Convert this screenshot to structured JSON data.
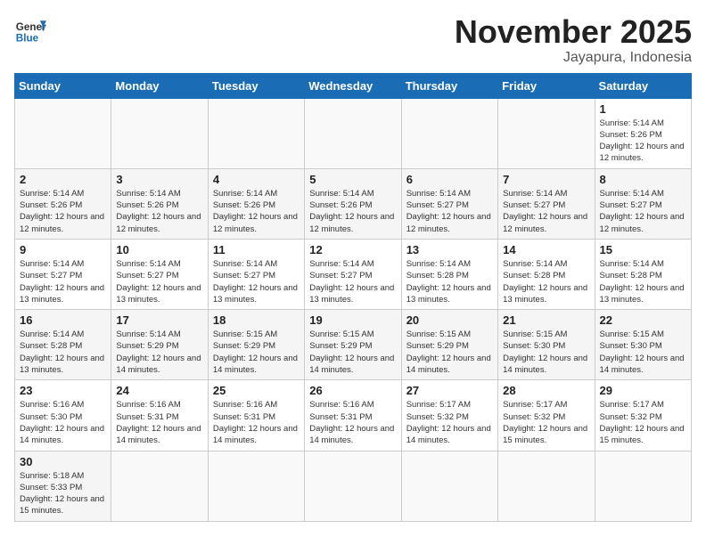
{
  "header": {
    "logo_general": "General",
    "logo_blue": "Blue",
    "month_title": "November 2025",
    "location": "Jayapura, Indonesia"
  },
  "weekdays": [
    "Sunday",
    "Monday",
    "Tuesday",
    "Wednesday",
    "Thursday",
    "Friday",
    "Saturday"
  ],
  "weeks": [
    [
      {
        "day": "",
        "sunrise": "",
        "sunset": "",
        "daylight": ""
      },
      {
        "day": "",
        "sunrise": "",
        "sunset": "",
        "daylight": ""
      },
      {
        "day": "",
        "sunrise": "",
        "sunset": "",
        "daylight": ""
      },
      {
        "day": "",
        "sunrise": "",
        "sunset": "",
        "daylight": ""
      },
      {
        "day": "",
        "sunrise": "",
        "sunset": "",
        "daylight": ""
      },
      {
        "day": "",
        "sunrise": "",
        "sunset": "",
        "daylight": ""
      },
      {
        "day": "1",
        "sunrise": "Sunrise: 5:14 AM",
        "sunset": "Sunset: 5:26 PM",
        "daylight": "Daylight: 12 hours and 12 minutes."
      }
    ],
    [
      {
        "day": "2",
        "sunrise": "Sunrise: 5:14 AM",
        "sunset": "Sunset: 5:26 PM",
        "daylight": "Daylight: 12 hours and 12 minutes."
      },
      {
        "day": "3",
        "sunrise": "Sunrise: 5:14 AM",
        "sunset": "Sunset: 5:26 PM",
        "daylight": "Daylight: 12 hours and 12 minutes."
      },
      {
        "day": "4",
        "sunrise": "Sunrise: 5:14 AM",
        "sunset": "Sunset: 5:26 PM",
        "daylight": "Daylight: 12 hours and 12 minutes."
      },
      {
        "day": "5",
        "sunrise": "Sunrise: 5:14 AM",
        "sunset": "Sunset: 5:26 PM",
        "daylight": "Daylight: 12 hours and 12 minutes."
      },
      {
        "day": "6",
        "sunrise": "Sunrise: 5:14 AM",
        "sunset": "Sunset: 5:27 PM",
        "daylight": "Daylight: 12 hours and 12 minutes."
      },
      {
        "day": "7",
        "sunrise": "Sunrise: 5:14 AM",
        "sunset": "Sunset: 5:27 PM",
        "daylight": "Daylight: 12 hours and 12 minutes."
      },
      {
        "day": "8",
        "sunrise": "Sunrise: 5:14 AM",
        "sunset": "Sunset: 5:27 PM",
        "daylight": "Daylight: 12 hours and 12 minutes."
      }
    ],
    [
      {
        "day": "9",
        "sunrise": "Sunrise: 5:14 AM",
        "sunset": "Sunset: 5:27 PM",
        "daylight": "Daylight: 12 hours and 13 minutes."
      },
      {
        "day": "10",
        "sunrise": "Sunrise: 5:14 AM",
        "sunset": "Sunset: 5:27 PM",
        "daylight": "Daylight: 12 hours and 13 minutes."
      },
      {
        "day": "11",
        "sunrise": "Sunrise: 5:14 AM",
        "sunset": "Sunset: 5:27 PM",
        "daylight": "Daylight: 12 hours and 13 minutes."
      },
      {
        "day": "12",
        "sunrise": "Sunrise: 5:14 AM",
        "sunset": "Sunset: 5:27 PM",
        "daylight": "Daylight: 12 hours and 13 minutes."
      },
      {
        "day": "13",
        "sunrise": "Sunrise: 5:14 AM",
        "sunset": "Sunset: 5:28 PM",
        "daylight": "Daylight: 12 hours and 13 minutes."
      },
      {
        "day": "14",
        "sunrise": "Sunrise: 5:14 AM",
        "sunset": "Sunset: 5:28 PM",
        "daylight": "Daylight: 12 hours and 13 minutes."
      },
      {
        "day": "15",
        "sunrise": "Sunrise: 5:14 AM",
        "sunset": "Sunset: 5:28 PM",
        "daylight": "Daylight: 12 hours and 13 minutes."
      }
    ],
    [
      {
        "day": "16",
        "sunrise": "Sunrise: 5:14 AM",
        "sunset": "Sunset: 5:28 PM",
        "daylight": "Daylight: 12 hours and 13 minutes."
      },
      {
        "day": "17",
        "sunrise": "Sunrise: 5:14 AM",
        "sunset": "Sunset: 5:29 PM",
        "daylight": "Daylight: 12 hours and 14 minutes."
      },
      {
        "day": "18",
        "sunrise": "Sunrise: 5:15 AM",
        "sunset": "Sunset: 5:29 PM",
        "daylight": "Daylight: 12 hours and 14 minutes."
      },
      {
        "day": "19",
        "sunrise": "Sunrise: 5:15 AM",
        "sunset": "Sunset: 5:29 PM",
        "daylight": "Daylight: 12 hours and 14 minutes."
      },
      {
        "day": "20",
        "sunrise": "Sunrise: 5:15 AM",
        "sunset": "Sunset: 5:29 PM",
        "daylight": "Daylight: 12 hours and 14 minutes."
      },
      {
        "day": "21",
        "sunrise": "Sunrise: 5:15 AM",
        "sunset": "Sunset: 5:30 PM",
        "daylight": "Daylight: 12 hours and 14 minutes."
      },
      {
        "day": "22",
        "sunrise": "Sunrise: 5:15 AM",
        "sunset": "Sunset: 5:30 PM",
        "daylight": "Daylight: 12 hours and 14 minutes."
      }
    ],
    [
      {
        "day": "23",
        "sunrise": "Sunrise: 5:16 AM",
        "sunset": "Sunset: 5:30 PM",
        "daylight": "Daylight: 12 hours and 14 minutes."
      },
      {
        "day": "24",
        "sunrise": "Sunrise: 5:16 AM",
        "sunset": "Sunset: 5:31 PM",
        "daylight": "Daylight: 12 hours and 14 minutes."
      },
      {
        "day": "25",
        "sunrise": "Sunrise: 5:16 AM",
        "sunset": "Sunset: 5:31 PM",
        "daylight": "Daylight: 12 hours and 14 minutes."
      },
      {
        "day": "26",
        "sunrise": "Sunrise: 5:16 AM",
        "sunset": "Sunset: 5:31 PM",
        "daylight": "Daylight: 12 hours and 14 minutes."
      },
      {
        "day": "27",
        "sunrise": "Sunrise: 5:17 AM",
        "sunset": "Sunset: 5:32 PM",
        "daylight": "Daylight: 12 hours and 14 minutes."
      },
      {
        "day": "28",
        "sunrise": "Sunrise: 5:17 AM",
        "sunset": "Sunset: 5:32 PM",
        "daylight": "Daylight: 12 hours and 15 minutes."
      },
      {
        "day": "29",
        "sunrise": "Sunrise: 5:17 AM",
        "sunset": "Sunset: 5:32 PM",
        "daylight": "Daylight: 12 hours and 15 minutes."
      }
    ],
    [
      {
        "day": "30",
        "sunrise": "Sunrise: 5:18 AM",
        "sunset": "Sunset: 5:33 PM",
        "daylight": "Daylight: 12 hours and 15 minutes."
      },
      {
        "day": "",
        "sunrise": "",
        "sunset": "",
        "daylight": ""
      },
      {
        "day": "",
        "sunrise": "",
        "sunset": "",
        "daylight": ""
      },
      {
        "day": "",
        "sunrise": "",
        "sunset": "",
        "daylight": ""
      },
      {
        "day": "",
        "sunrise": "",
        "sunset": "",
        "daylight": ""
      },
      {
        "day": "",
        "sunrise": "",
        "sunset": "",
        "daylight": ""
      },
      {
        "day": "",
        "sunrise": "",
        "sunset": "",
        "daylight": ""
      }
    ]
  ]
}
